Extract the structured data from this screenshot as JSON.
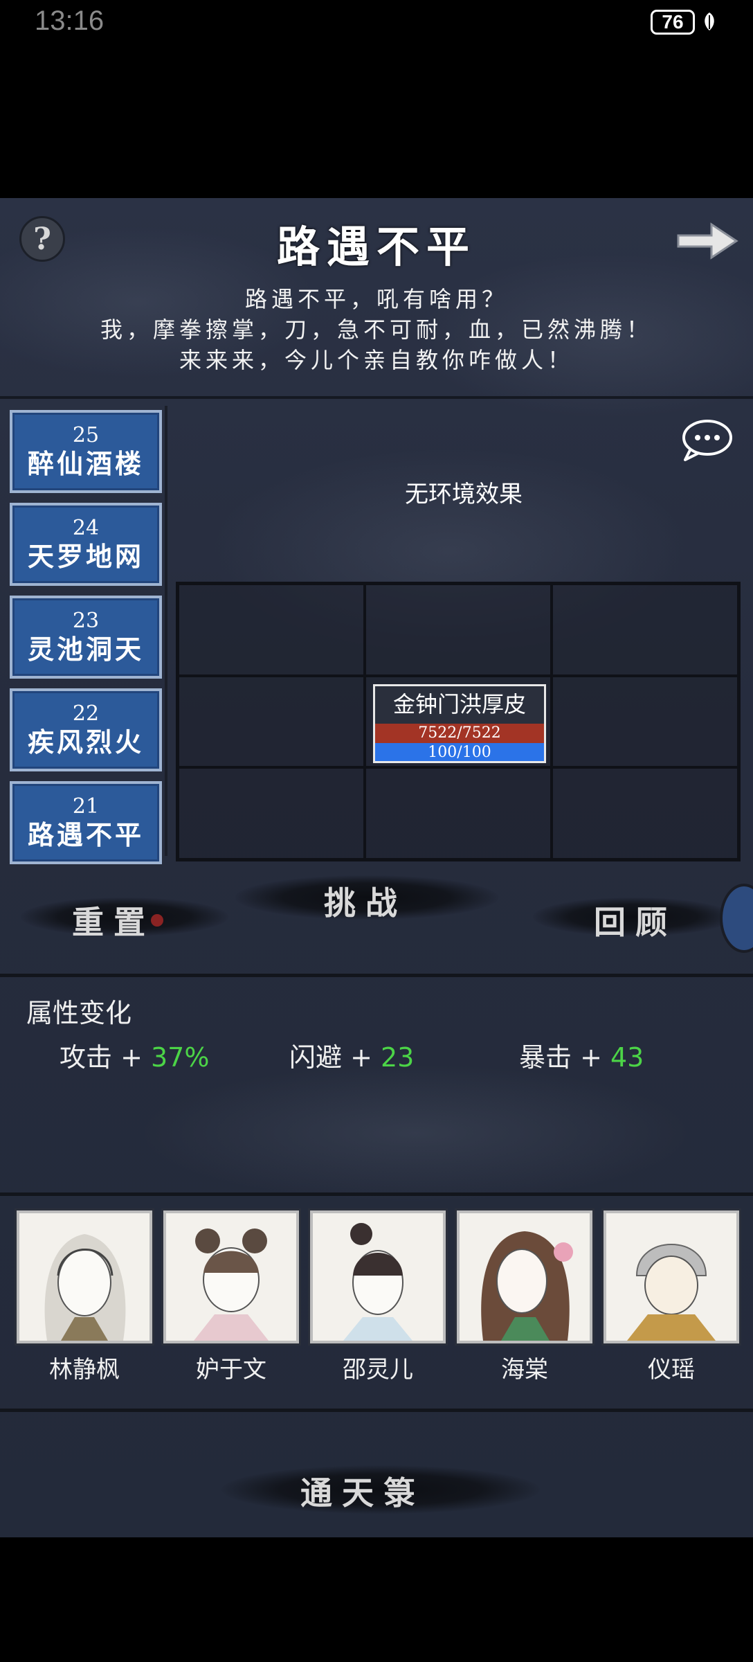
{
  "status": {
    "time": "13:16",
    "battery": "76"
  },
  "header": {
    "title": "路遇不平",
    "poem": [
      "路遇不平，吼有啥用？",
      "我，摩拳擦掌，刀，急不可耐，血，已然沸腾！",
      "来来来，今儿个亲自教你咋做人！"
    ]
  },
  "levels": [
    {
      "num": "25",
      "name": "醉仙酒楼"
    },
    {
      "num": "24",
      "name": "天罗地网"
    },
    {
      "num": "23",
      "name": "灵池洞天"
    },
    {
      "num": "22",
      "name": "疾风烈火"
    },
    {
      "num": "21",
      "name": "路遇不平"
    }
  ],
  "environment": "无环境效果",
  "enemy": {
    "name": "金钟门洪厚皮",
    "hp": "7522/7522",
    "mp": "100/100",
    "hp_fraction": 1.0,
    "mp_fraction": 1.0
  },
  "actions": {
    "reset": "重置",
    "challenge": "挑战",
    "review": "回顾"
  },
  "attributes": {
    "title": "属性变化",
    "items": [
      {
        "label": "攻击 + ",
        "value": "37%"
      },
      {
        "label": "闪避 + ",
        "value": "23"
      },
      {
        "label": "暴击 + ",
        "value": "43"
      }
    ]
  },
  "party": [
    "林静枫",
    "妒于文",
    "邵灵儿",
    "海棠",
    "仪瑶"
  ],
  "bottom_button": "通天箓",
  "colors": {
    "level_bg": "#2c5a9a",
    "hp": "#a33425",
    "mp": "#2b73e8",
    "buff": "#4cd447"
  }
}
